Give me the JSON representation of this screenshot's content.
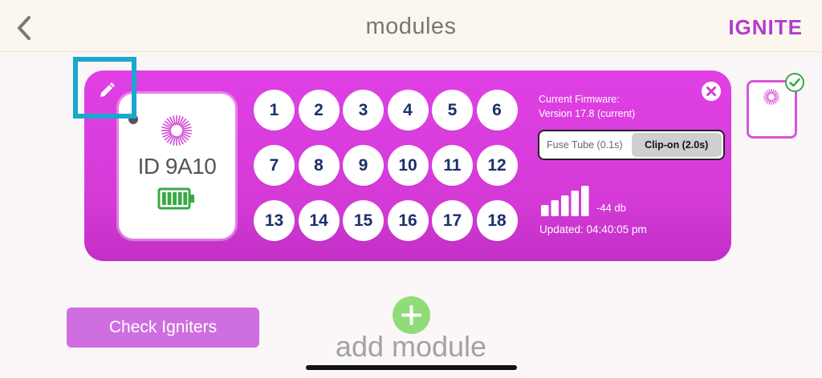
{
  "header": {
    "title": "modules",
    "brand": "IGNITE"
  },
  "module": {
    "id_label": "ID 9A10",
    "numbers": [
      "1",
      "2",
      "3",
      "4",
      "5",
      "6",
      "7",
      "8",
      "9",
      "10",
      "11",
      "12",
      "13",
      "14",
      "15",
      "16",
      "17",
      "18"
    ],
    "firmware_line1": "Current Firmware:",
    "firmware_line2": "Version 17.8 (current)",
    "mode_options": [
      {
        "label": "Fuse Tube (0.1s)",
        "active": false
      },
      {
        "label": "Clip-on (2.0s)",
        "active": true
      }
    ],
    "signal_db": "-44 db",
    "signal_bars": 5,
    "updated": "Updated: 04:40:05 pm",
    "battery_level": 1.0
  },
  "footer": {
    "check_button": "Check Igniters",
    "add_module": "add module"
  },
  "colors": {
    "card": "#d43ad6",
    "brand": "#b13bd0",
    "number_text": "#1b2f6b",
    "highlight": "#18a9cc",
    "battery": "#3aa845",
    "add": "#8fdc78"
  },
  "icons": [
    "chevron-left-icon",
    "pencil-icon",
    "sunburst-icon",
    "battery-icon",
    "close-icon",
    "signal-icon",
    "check-icon",
    "plus-icon"
  ]
}
